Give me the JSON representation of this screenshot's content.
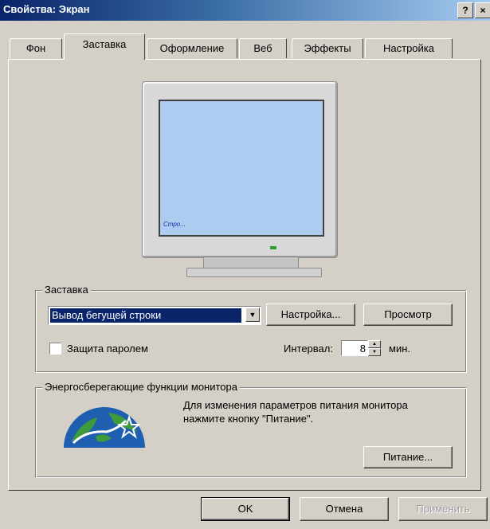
{
  "window": {
    "title": "Свойства: Экран"
  },
  "titlebar": {
    "help": "?",
    "close": "×"
  },
  "tabs": [
    {
      "label": "Фон"
    },
    {
      "label": "Заставка"
    },
    {
      "label": "Оформление"
    },
    {
      "label": "Веб"
    },
    {
      "label": "Эффекты"
    },
    {
      "label": "Настройка"
    }
  ],
  "preview": {
    "marquee_text": "Стро..."
  },
  "screensaver": {
    "group_label": "Заставка",
    "selected": "Вывод бегущей строки",
    "settings_button": "Настройка...",
    "preview_button": "Просмотр",
    "password_label": "Защита паролем",
    "password_checked": false,
    "interval_label": "Интервал:",
    "interval_value": "8",
    "interval_unit": "мин."
  },
  "energy": {
    "group_label": "Энергосберегающие функции монитора",
    "description": "Для изменения параметров питания монитора нажмите кнопку \"Питание\".",
    "power_button": "Питание..."
  },
  "footer": {
    "ok": "OK",
    "cancel": "Отмена",
    "apply": "Применить"
  },
  "colors": {
    "selection": "#0a246a",
    "screen": "#aecbf0",
    "face": "#d4d0c8"
  },
  "icons": [
    "help-icon",
    "close-icon",
    "dropdown-arrow-icon",
    "spin-up-icon",
    "spin-down-icon",
    "energy-star-icon"
  ]
}
